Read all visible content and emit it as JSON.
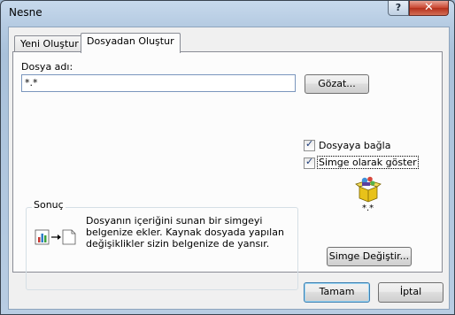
{
  "window": {
    "title": "Nesne"
  },
  "titlebar": {
    "help_label": "?",
    "close_label": "✕"
  },
  "tabs": [
    {
      "label": "Yeni Oluştur"
    },
    {
      "label": "Dosyadan Oluştur"
    }
  ],
  "form": {
    "filename_label": "Dosya adı:",
    "filename_value": "*.*",
    "browse_label": "Gözat...",
    "link_label": "Dosyaya bağla",
    "link_checked": true,
    "icon_label": "Simge olarak göster",
    "icon_checked": true,
    "icon_caption": "*.*",
    "change_icon_label": "Simge Değiştir..."
  },
  "result": {
    "title": "Sonuç",
    "text": "Dosyanın içeriğini sunan bir simgeyi belgenize ekler. Kaynak dosyada yapılan değişiklikler sizin belgenize de yansır."
  },
  "footer": {
    "ok_label": "Tamam",
    "cancel_label": "İptal"
  }
}
